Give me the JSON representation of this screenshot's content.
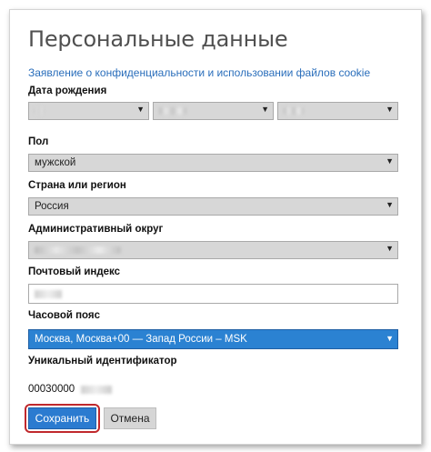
{
  "page": {
    "title": "Персональные данные",
    "privacy_link": "Заявление о конфиденциальности и использовании файлов cookie"
  },
  "birth_date": {
    "label": "Дата рождения",
    "day_value": "",
    "month_value": "",
    "year_value": ""
  },
  "gender": {
    "label": "Пол",
    "value": "мужской"
  },
  "country": {
    "label": "Страна или регион",
    "value": "Россия"
  },
  "district": {
    "label": "Административный округ",
    "value": ""
  },
  "postal": {
    "label": "Почтовый индекс",
    "value": ""
  },
  "timezone": {
    "label": "Часовой пояс",
    "value": "Москва, Москва+00 — Запад России – MSK"
  },
  "unique_id": {
    "label": "Уникальный идентификатор",
    "value_prefix": "00030000"
  },
  "buttons": {
    "save": "Сохранить",
    "cancel": "Отмена"
  },
  "colors": {
    "accent": "#2b7bd0",
    "highlight": "#c0282c",
    "link": "#2a6ebb"
  }
}
